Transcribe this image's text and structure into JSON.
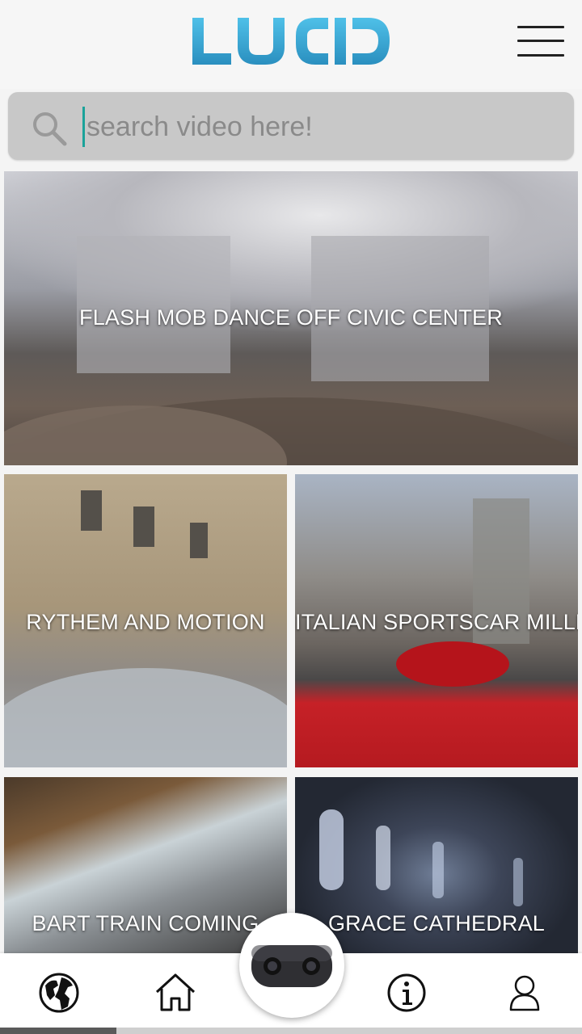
{
  "app": {
    "logo_text": "LUCID",
    "accent_color": "#3aa9d8"
  },
  "header": {
    "menu_icon": "hamburger-menu-icon"
  },
  "search": {
    "placeholder": "search video here!",
    "value": "",
    "icon": "search-icon"
  },
  "videos": [
    {
      "title": "FLASH MOB DANCE OFF CIVIC CENTER"
    },
    {
      "title": "RYTHEM AND MOTION"
    },
    {
      "title": "ITALIAN SPORTSCAR MILLE"
    },
    {
      "title": "BART TRAIN COMING"
    },
    {
      "title": "GRACE CATHEDRAL"
    }
  ],
  "bottom_nav": {
    "items": [
      {
        "icon": "globe-icon"
      },
      {
        "icon": "home-icon"
      },
      {
        "icon": "camera-icon"
      },
      {
        "icon": "info-icon"
      },
      {
        "icon": "profile-icon"
      }
    ]
  }
}
